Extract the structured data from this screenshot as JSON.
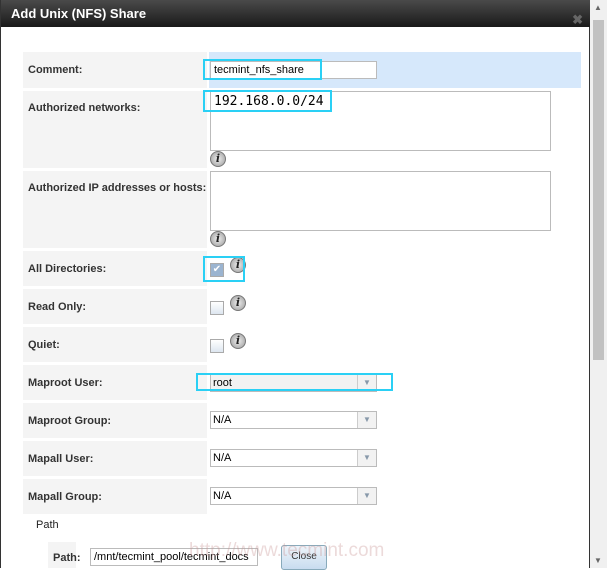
{
  "dialog": {
    "title": "Add Unix (NFS) Share",
    "close_icon": "close-icon"
  },
  "fields": {
    "comment": {
      "label": "Comment:",
      "value": "tecmint_nfs_share"
    },
    "networks": {
      "label": "Authorized networks:",
      "value": "192.168.0.0/24"
    },
    "hosts": {
      "label": "Authorized IP addresses or hosts:",
      "value": ""
    },
    "all_dirs": {
      "label": "All Directories:",
      "checked": true
    },
    "read_only": {
      "label": "Read Only:",
      "checked": false
    },
    "quiet": {
      "label": "Quiet:",
      "checked": false
    },
    "maproot_user": {
      "label": "Maproot User:",
      "value": "root"
    },
    "maproot_group": {
      "label": "Maproot Group:",
      "value": "N/A"
    },
    "mapall_user": {
      "label": "Mapall User:",
      "value": "N/A"
    },
    "mapall_group": {
      "label": "Mapall Group:",
      "value": "N/A"
    }
  },
  "path": {
    "section": "Path",
    "label": "Path:",
    "value": "/mnt/tecmint_pool/tecmint_docs",
    "close_label": "Close"
  },
  "watermark": "http://www.tecmint.com",
  "info_glyph": "i"
}
